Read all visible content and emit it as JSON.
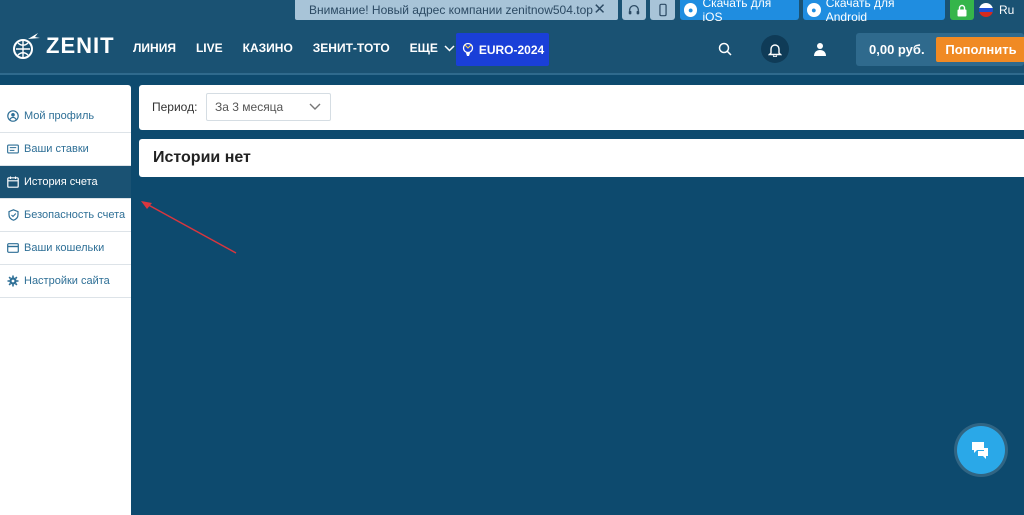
{
  "topbar": {
    "notice": "Внимание! Новый адрес компании zenitnow504.top",
    "download_ios": "Скачать для iOS",
    "download_android": "Скачать для Android",
    "language": "Ru"
  },
  "header": {
    "logo": "ZENIT",
    "nav": [
      "ЛИНИЯ",
      "LIVE",
      "КАЗИНО",
      "ЗЕНИТ-ТОТО",
      "ЕЩЕ"
    ],
    "euro": "EURO-2024",
    "balance": "0,00 руб.",
    "topup": "Пополнить"
  },
  "sidebar": {
    "items": [
      {
        "label": "Мой профиль",
        "icon": "user-circle-icon"
      },
      {
        "label": "Ваши ставки",
        "icon": "ticket-icon"
      },
      {
        "label": "История счета",
        "icon": "calendar-icon"
      },
      {
        "label": "Безопасность счета",
        "icon": "shield-icon"
      },
      {
        "label": "Ваши кошельки",
        "icon": "wallet-icon"
      },
      {
        "label": "Настройки сайта",
        "icon": "gear-icon"
      }
    ],
    "active_index": 2
  },
  "main": {
    "period_label": "Период:",
    "period_value": "За 3 месяца",
    "empty_text": "Истории нет"
  },
  "colors": {
    "header_bg": "#1a5273",
    "page_bg": "#0d4a6e",
    "accent_orange": "#f08a24",
    "download_blue": "#1f8de0",
    "euro_blue": "#1a3fd8",
    "arrow_red": "#d9363e"
  }
}
